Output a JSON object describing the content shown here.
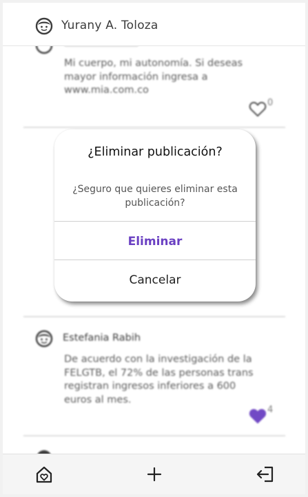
{
  "header": {
    "user_name": "Yurany A. Toloza"
  },
  "posts": [
    {
      "text": "Mi cuerpo, mi autonomía. Si deseas mayor información ingresa a www.mia.com.co",
      "likes": "0",
      "liked": false
    },
    {
      "author": "Estefania Rabih",
      "text": "De acuerdo con la investigación de la FELGTB, el 72% de las personas trans registran ingresos inferiores a 600 euros al mes.",
      "likes": "4",
      "liked": true
    }
  ],
  "dialog": {
    "title": "¿Eliminar publicación?",
    "message": "¿Seguro que quieres eliminar esta publicación?",
    "confirm_label": "Eliminar",
    "cancel_label": "Cancelar"
  },
  "bottom_nav": {
    "icons": [
      "home-icon",
      "plus-icon",
      "logout-icon"
    ]
  },
  "colors": {
    "accent": "#6a40c2",
    "like_filled": "#6a40c2"
  }
}
